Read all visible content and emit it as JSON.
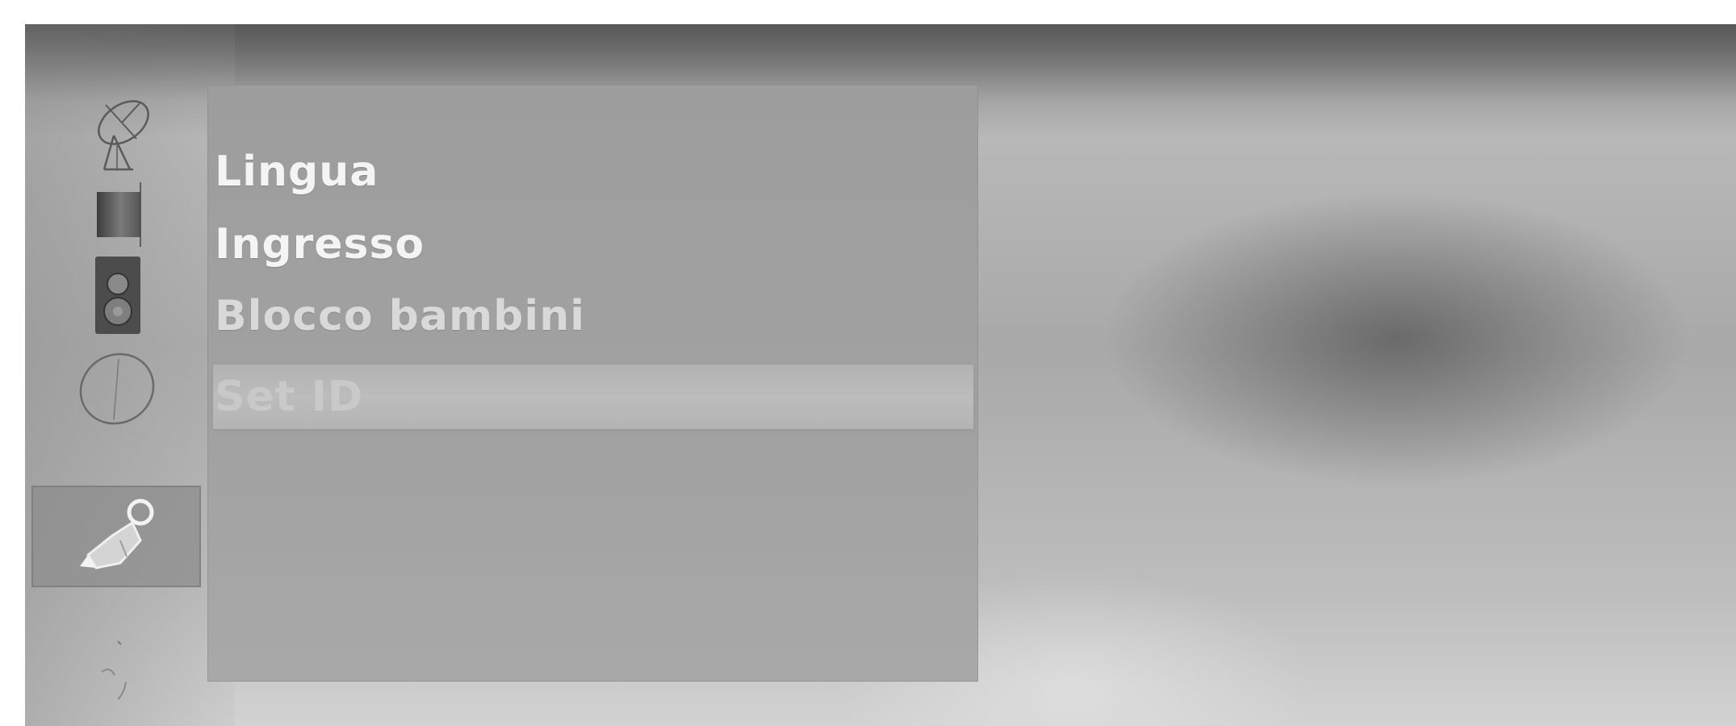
{
  "menu": {
    "items": [
      {
        "label": "Lingua",
        "state": "normal"
      },
      {
        "label": "Ingresso",
        "state": "normal"
      },
      {
        "label": "Blocco bambini",
        "state": "dim"
      },
      {
        "label": "Set ID",
        "state": "selected"
      }
    ]
  },
  "sidebar": {
    "icons": [
      {
        "icon": "satellite-dish-icon"
      },
      {
        "icon": "picture-icon"
      },
      {
        "icon": "speaker-icon"
      },
      {
        "icon": "clock-icon"
      },
      {
        "icon": "option-icon",
        "selected": true
      },
      {
        "icon": "screen-icon"
      }
    ]
  },
  "colors": {
    "panel": "#a0a0a0",
    "highlight": "#b8b8b8",
    "text": "#f4f4f4"
  }
}
